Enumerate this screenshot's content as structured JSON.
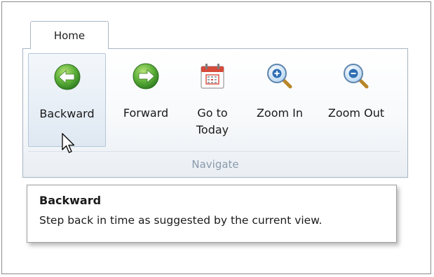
{
  "ribbon": {
    "active_tab": "Home",
    "group_label": "Navigate",
    "buttons": [
      {
        "label": "Backward",
        "icon": "arrow-left-circle-icon"
      },
      {
        "label": "Forward",
        "icon": "arrow-right-circle-icon"
      },
      {
        "label_line1": "Go to",
        "label_line2": "Today",
        "icon": "calendar-icon"
      },
      {
        "label": "Zoom In",
        "icon": "zoom-in-icon"
      },
      {
        "label": "Zoom Out",
        "icon": "zoom-out-icon"
      }
    ],
    "hovered_button": "Backward"
  },
  "tooltip": {
    "title": "Backward",
    "text": "Step back in time as suggested by the current view."
  },
  "colors": {
    "icon_green": "#55a83a",
    "ribbon_border": "#a9b6c4",
    "group_label": "#8a9aab",
    "calendar_red": "#d64a3a"
  }
}
